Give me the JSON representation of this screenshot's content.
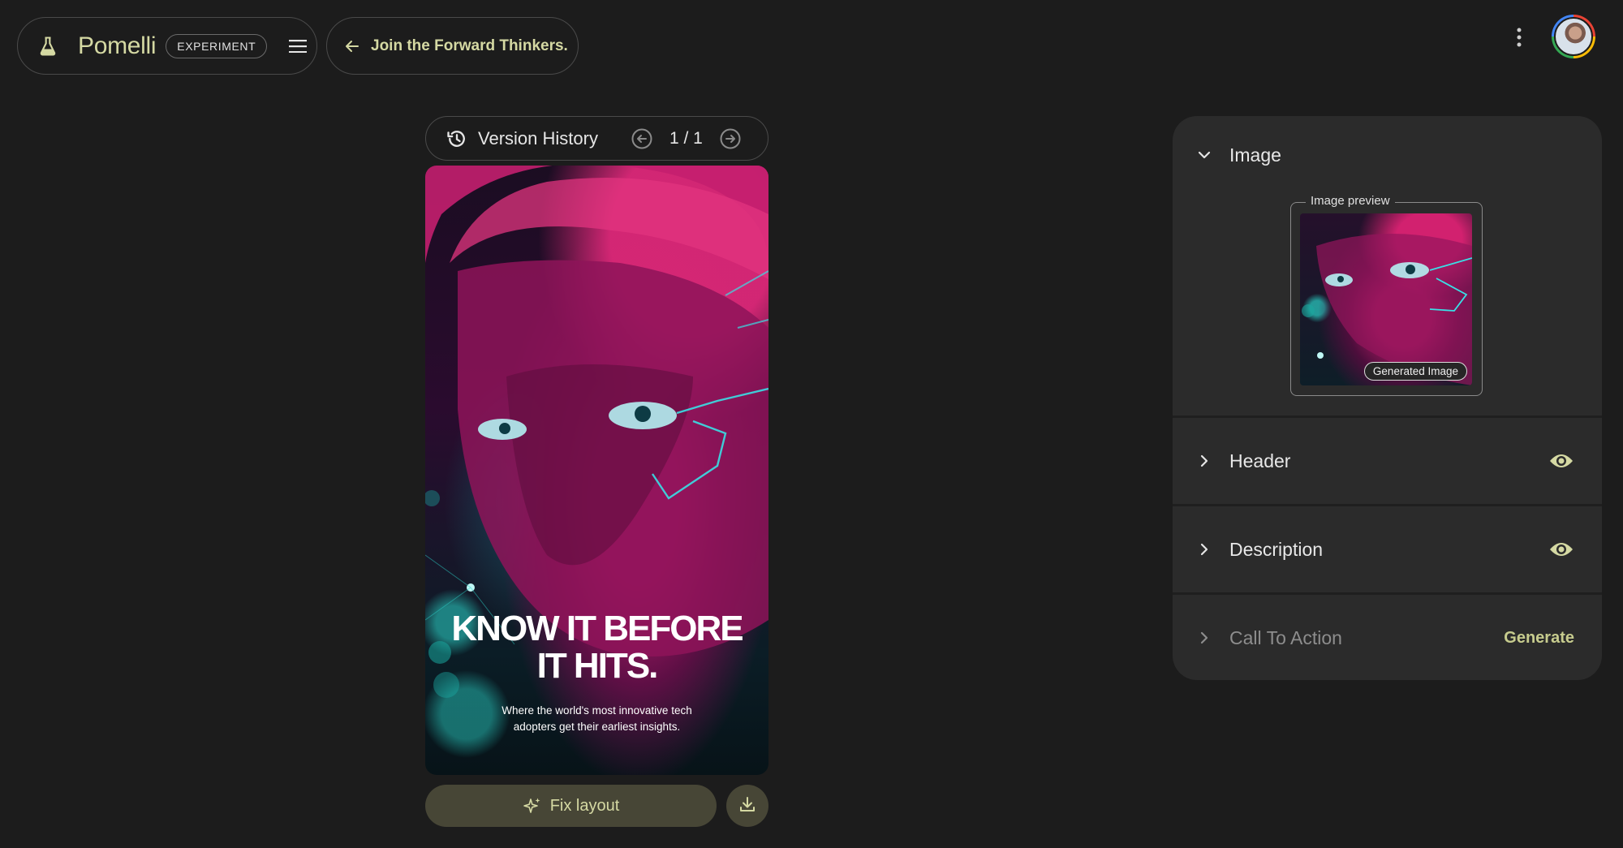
{
  "header": {
    "app_name": "Pomelli",
    "badge": "EXPERIMENT",
    "back_label": "Join the Forward Thinkers."
  },
  "icons": {
    "flask": "flask-icon",
    "menu": "menu-icon",
    "back": "arrow-left-icon",
    "more": "more-vert-icon",
    "history": "history-icon",
    "prev": "arrow-circle-left-icon",
    "next": "arrow-circle-right-icon",
    "sparkle": "sparkle-icon",
    "download": "download-icon",
    "eye": "eye-icon"
  },
  "version": {
    "label": "Version History",
    "count": "1 / 1"
  },
  "poster": {
    "headline_line1": "KNOW IT BEFORE",
    "headline_line2": "IT HITS.",
    "subtext_line1": "Where the world's most innovative tech",
    "subtext_line2": "adopters get their earliest insights."
  },
  "actions": {
    "fix_layout": "Fix layout"
  },
  "panel": {
    "image": {
      "title": "Image",
      "preview_legend": "Image preview",
      "tag": "Generated Image"
    },
    "header_section": {
      "title": "Header"
    },
    "description_section": {
      "title": "Description"
    },
    "cta_section": {
      "title": "Call To Action",
      "action": "Generate"
    }
  },
  "colors": {
    "background": "#1c1c1c",
    "panel": "#2b2b2b",
    "accent": "#d5d9a3",
    "button_fill": "#474636"
  }
}
